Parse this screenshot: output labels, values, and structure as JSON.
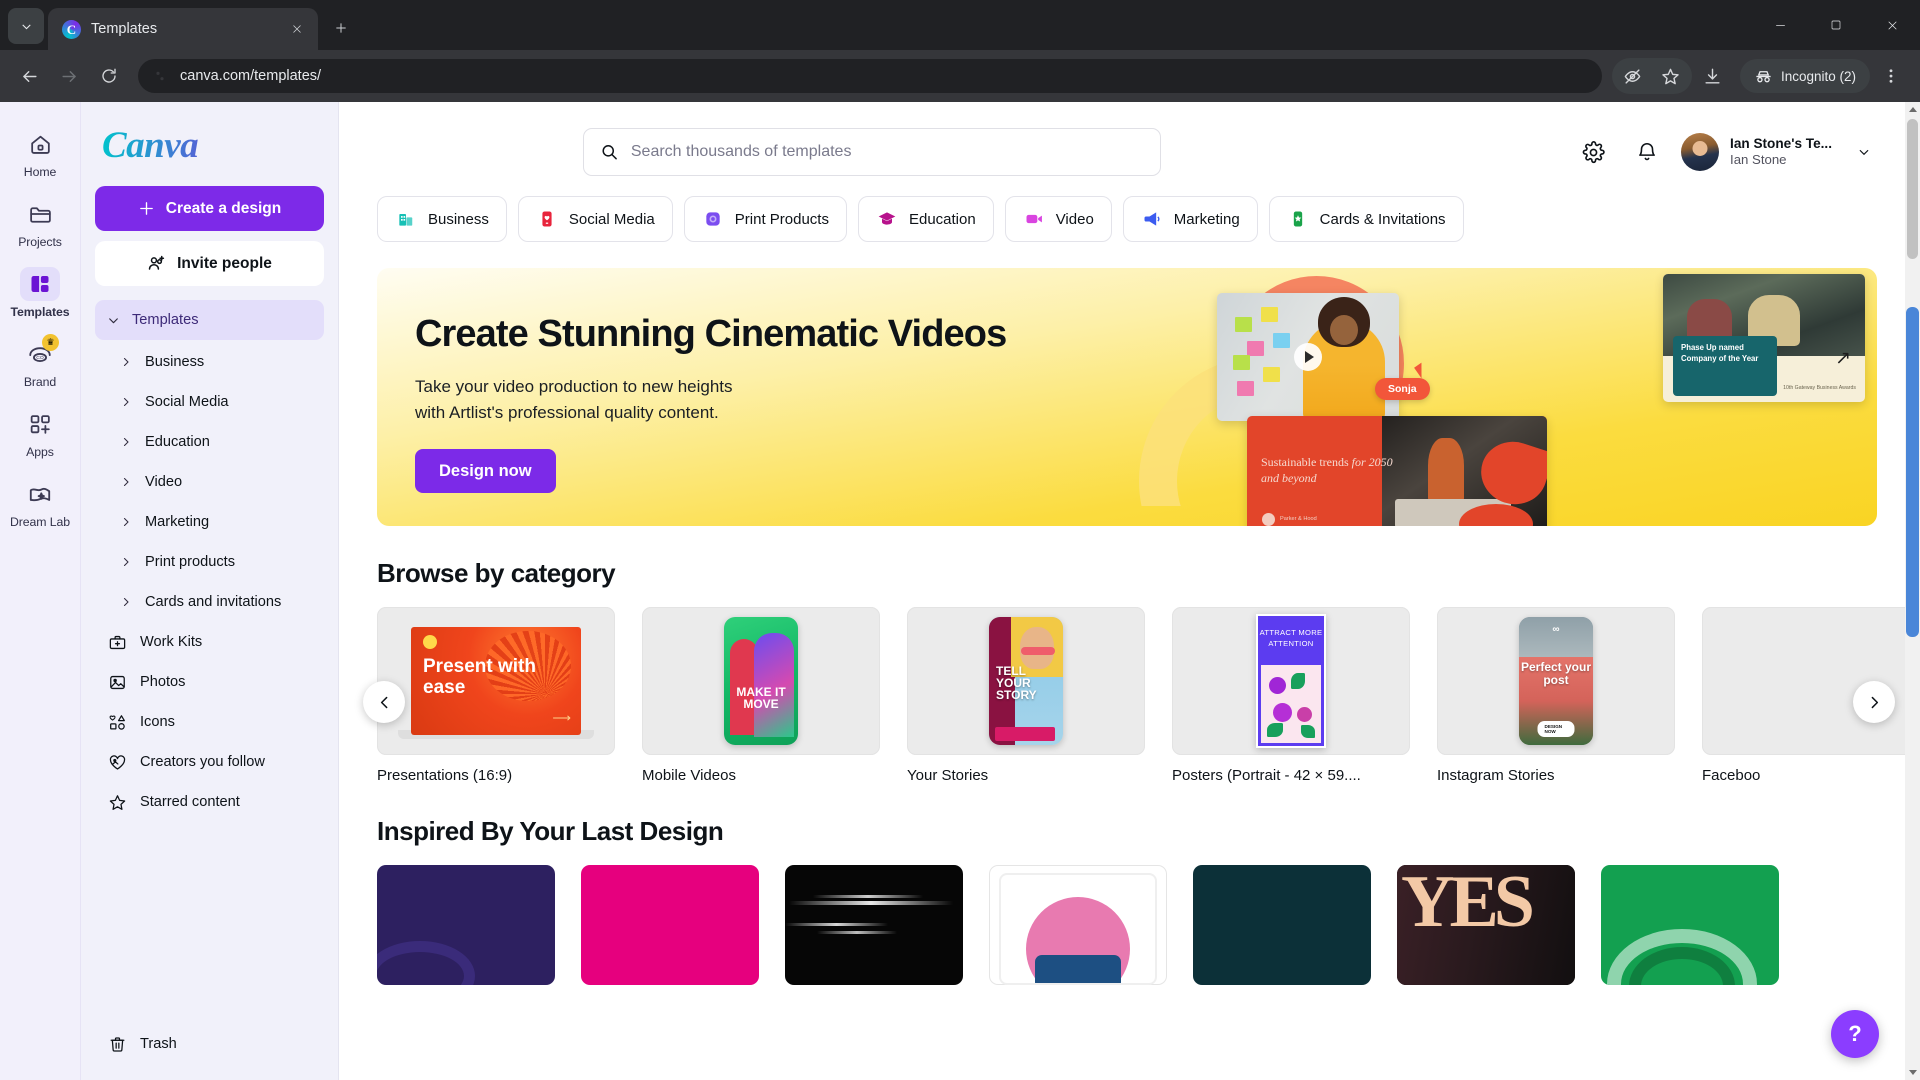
{
  "browser": {
    "tab": {
      "title": "Templates",
      "favicon": "canva-icon"
    },
    "url": "canva.com/templates/",
    "profile_label": "Incognito (2)",
    "icons": {
      "tab_list": "chevron-down-icon",
      "close": "close-icon",
      "new_tab": "plus-icon",
      "back": "back-arrow-icon",
      "forward": "forward-arrow-icon",
      "reload": "reload-icon",
      "site_info": "page-settings-icon",
      "tracking": "eye-off-icon",
      "bookmark": "star-icon",
      "downloads": "download-icon",
      "incognito": "incognito-icon",
      "menu": "three-dots-menu-icon",
      "minimize": "minimize-icon",
      "maximize": "maximize-icon",
      "window_close": "window-close-icon"
    }
  },
  "rail": {
    "items": [
      {
        "label": "Home",
        "icon": "home-icon",
        "active": false,
        "badge": ""
      },
      {
        "label": "Projects",
        "icon": "folder-icon",
        "active": false,
        "badge": ""
      },
      {
        "label": "Templates",
        "icon": "templates-icon",
        "active": true,
        "badge": ""
      },
      {
        "label": "Brand",
        "icon": "brand-icon",
        "active": false,
        "badge": "crown"
      },
      {
        "label": "Apps",
        "icon": "apps-icon",
        "active": false,
        "badge": ""
      },
      {
        "label": "Dream Lab",
        "icon": "dream-lab-icon",
        "active": false,
        "badge": ""
      }
    ]
  },
  "sidebar": {
    "logo": "Canva",
    "create_button": "Create a design",
    "invite_button": "Invite people",
    "templates_header": "Templates",
    "sub_items": [
      {
        "label": "Business"
      },
      {
        "label": "Social Media"
      },
      {
        "label": "Education"
      },
      {
        "label": "Video"
      },
      {
        "label": "Marketing"
      },
      {
        "label": "Print products"
      },
      {
        "label": "Cards and invitations"
      }
    ],
    "links": [
      {
        "label": "Work Kits",
        "icon": "briefcase-icon"
      },
      {
        "label": "Photos",
        "icon": "image-icon"
      },
      {
        "label": "Icons",
        "icon": "shapes-icon"
      },
      {
        "label": "Creators you follow",
        "icon": "heart-image-icon"
      },
      {
        "label": "Starred content",
        "icon": "star-icon"
      }
    ],
    "trash": {
      "label": "Trash",
      "icon": "trash-icon"
    }
  },
  "header": {
    "search_placeholder": "Search thousands of templates",
    "search_value": "",
    "settings_icon": "gear-icon",
    "notifications_icon": "bell-icon",
    "account": {
      "team": "Ian Stone's Te...",
      "user": "Ian Stone"
    },
    "chevron": "chevron-down-icon"
  },
  "chips": [
    {
      "label": "Business",
      "icon": "building-icon",
      "color": "#16c0b5"
    },
    {
      "label": "Social Media",
      "icon": "heart-post-icon",
      "color": "#e8243c"
    },
    {
      "label": "Print Products",
      "icon": "print-icon",
      "color": "#7b4df0"
    },
    {
      "label": "Education",
      "icon": "graduation-cap-icon",
      "color": "#b7128c"
    },
    {
      "label": "Video",
      "icon": "video-camera-icon",
      "color": "#d944e0"
    },
    {
      "label": "Marketing",
      "icon": "megaphone-icon",
      "color": "#3c5cf0"
    },
    {
      "label": "Cards & Invitations",
      "icon": "card-icon",
      "color": "#1aa34a"
    }
  ],
  "hero": {
    "title": "Create Stunning Cinematic Videos",
    "body_line1": "Take your video production to new heights",
    "body_line2": "with Artlist's professional quality content.",
    "cta": "Design now",
    "art": {
      "name_badge": "Sonja",
      "award_text": "Phase Up named Company of the Year",
      "award_meta": "10th Gateway Business Awards",
      "sustain_text_plain": "Sustainable trends ",
      "sustain_text_italic": "for 2050 and beyond",
      "sustain_brand": "Parker & Hood"
    }
  },
  "browse": {
    "title": "Browse by category",
    "prev_icon": "chevron-left-icon",
    "next_icon": "chevron-right-icon",
    "cards": [
      {
        "label": "Presentations (16:9)",
        "thumb_text": "Present with ease",
        "thumb_kind": "presentation"
      },
      {
        "label": "Mobile Videos",
        "thumb_text": "MAKE IT MOVE",
        "thumb_kind": "mobile-video"
      },
      {
        "label": "Your Stories",
        "thumb_text": "TELL YOUR STORY",
        "thumb_kind": "story"
      },
      {
        "label": "Posters (Portrait - 42 × 59....",
        "thumb_text": "ATTRACT MORE ATTENTION",
        "thumb_kind": "poster"
      },
      {
        "label": "Instagram Stories",
        "thumb_text": "Perfect your post",
        "thumb_kind": "instagram"
      },
      {
        "label": "Faceboo",
        "thumb_text": "",
        "thumb_kind": "blank"
      }
    ]
  },
  "inspired": {
    "title": "Inspired By Your Last Design",
    "cards": [
      {
        "color": "#2d2060",
        "kind": "solid-purple"
      },
      {
        "color": "#e6007e",
        "kind": "solid-magenta"
      },
      {
        "color": "#060606",
        "kind": "dark-streaks"
      },
      {
        "color": "#ffffff",
        "kind": "white-pink"
      },
      {
        "color": "#0c3038",
        "kind": "solid-teal"
      },
      {
        "color": "#111111",
        "kind": "yes-dark"
      },
      {
        "color": "#13a050",
        "kind": "green-arcs"
      }
    ]
  },
  "help": {
    "label": "?"
  }
}
